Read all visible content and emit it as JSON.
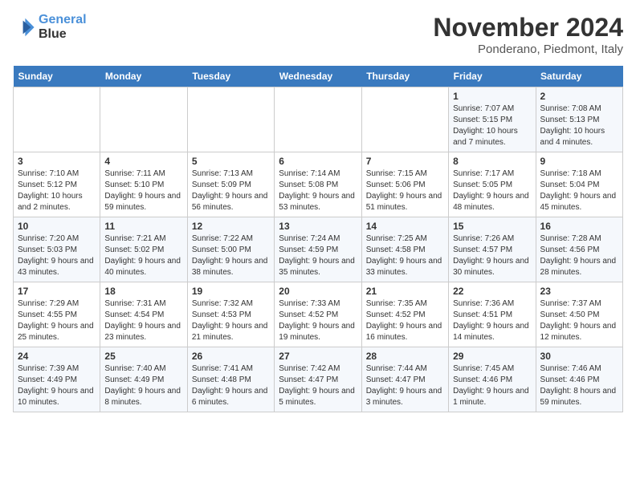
{
  "logo": {
    "line1": "General",
    "line2": "Blue"
  },
  "title": "November 2024",
  "location": "Ponderano, Piedmont, Italy",
  "header": {
    "accent_color": "#3a7abf"
  },
  "weekdays": [
    "Sunday",
    "Monday",
    "Tuesday",
    "Wednesday",
    "Thursday",
    "Friday",
    "Saturday"
  ],
  "weeks": [
    [
      {
        "day": "",
        "info": ""
      },
      {
        "day": "",
        "info": ""
      },
      {
        "day": "",
        "info": ""
      },
      {
        "day": "",
        "info": ""
      },
      {
        "day": "",
        "info": ""
      },
      {
        "day": "1",
        "info": "Sunrise: 7:07 AM\nSunset: 5:15 PM\nDaylight: 10 hours and 7 minutes."
      },
      {
        "day": "2",
        "info": "Sunrise: 7:08 AM\nSunset: 5:13 PM\nDaylight: 10 hours and 4 minutes."
      }
    ],
    [
      {
        "day": "3",
        "info": "Sunrise: 7:10 AM\nSunset: 5:12 PM\nDaylight: 10 hours and 2 minutes."
      },
      {
        "day": "4",
        "info": "Sunrise: 7:11 AM\nSunset: 5:10 PM\nDaylight: 9 hours and 59 minutes."
      },
      {
        "day": "5",
        "info": "Sunrise: 7:13 AM\nSunset: 5:09 PM\nDaylight: 9 hours and 56 minutes."
      },
      {
        "day": "6",
        "info": "Sunrise: 7:14 AM\nSunset: 5:08 PM\nDaylight: 9 hours and 53 minutes."
      },
      {
        "day": "7",
        "info": "Sunrise: 7:15 AM\nSunset: 5:06 PM\nDaylight: 9 hours and 51 minutes."
      },
      {
        "day": "8",
        "info": "Sunrise: 7:17 AM\nSunset: 5:05 PM\nDaylight: 9 hours and 48 minutes."
      },
      {
        "day": "9",
        "info": "Sunrise: 7:18 AM\nSunset: 5:04 PM\nDaylight: 9 hours and 45 minutes."
      }
    ],
    [
      {
        "day": "10",
        "info": "Sunrise: 7:20 AM\nSunset: 5:03 PM\nDaylight: 9 hours and 43 minutes."
      },
      {
        "day": "11",
        "info": "Sunrise: 7:21 AM\nSunset: 5:02 PM\nDaylight: 9 hours and 40 minutes."
      },
      {
        "day": "12",
        "info": "Sunrise: 7:22 AM\nSunset: 5:00 PM\nDaylight: 9 hours and 38 minutes."
      },
      {
        "day": "13",
        "info": "Sunrise: 7:24 AM\nSunset: 4:59 PM\nDaylight: 9 hours and 35 minutes."
      },
      {
        "day": "14",
        "info": "Sunrise: 7:25 AM\nSunset: 4:58 PM\nDaylight: 9 hours and 33 minutes."
      },
      {
        "day": "15",
        "info": "Sunrise: 7:26 AM\nSunset: 4:57 PM\nDaylight: 9 hours and 30 minutes."
      },
      {
        "day": "16",
        "info": "Sunrise: 7:28 AM\nSunset: 4:56 PM\nDaylight: 9 hours and 28 minutes."
      }
    ],
    [
      {
        "day": "17",
        "info": "Sunrise: 7:29 AM\nSunset: 4:55 PM\nDaylight: 9 hours and 25 minutes."
      },
      {
        "day": "18",
        "info": "Sunrise: 7:31 AM\nSunset: 4:54 PM\nDaylight: 9 hours and 23 minutes."
      },
      {
        "day": "19",
        "info": "Sunrise: 7:32 AM\nSunset: 4:53 PM\nDaylight: 9 hours and 21 minutes."
      },
      {
        "day": "20",
        "info": "Sunrise: 7:33 AM\nSunset: 4:52 PM\nDaylight: 9 hours and 19 minutes."
      },
      {
        "day": "21",
        "info": "Sunrise: 7:35 AM\nSunset: 4:52 PM\nDaylight: 9 hours and 16 minutes."
      },
      {
        "day": "22",
        "info": "Sunrise: 7:36 AM\nSunset: 4:51 PM\nDaylight: 9 hours and 14 minutes."
      },
      {
        "day": "23",
        "info": "Sunrise: 7:37 AM\nSunset: 4:50 PM\nDaylight: 9 hours and 12 minutes."
      }
    ],
    [
      {
        "day": "24",
        "info": "Sunrise: 7:39 AM\nSunset: 4:49 PM\nDaylight: 9 hours and 10 minutes."
      },
      {
        "day": "25",
        "info": "Sunrise: 7:40 AM\nSunset: 4:49 PM\nDaylight: 9 hours and 8 minutes."
      },
      {
        "day": "26",
        "info": "Sunrise: 7:41 AM\nSunset: 4:48 PM\nDaylight: 9 hours and 6 minutes."
      },
      {
        "day": "27",
        "info": "Sunrise: 7:42 AM\nSunset: 4:47 PM\nDaylight: 9 hours and 5 minutes."
      },
      {
        "day": "28",
        "info": "Sunrise: 7:44 AM\nSunset: 4:47 PM\nDaylight: 9 hours and 3 minutes."
      },
      {
        "day": "29",
        "info": "Sunrise: 7:45 AM\nSunset: 4:46 PM\nDaylight: 9 hours and 1 minute."
      },
      {
        "day": "30",
        "info": "Sunrise: 7:46 AM\nSunset: 4:46 PM\nDaylight: 8 hours and 59 minutes."
      }
    ]
  ]
}
